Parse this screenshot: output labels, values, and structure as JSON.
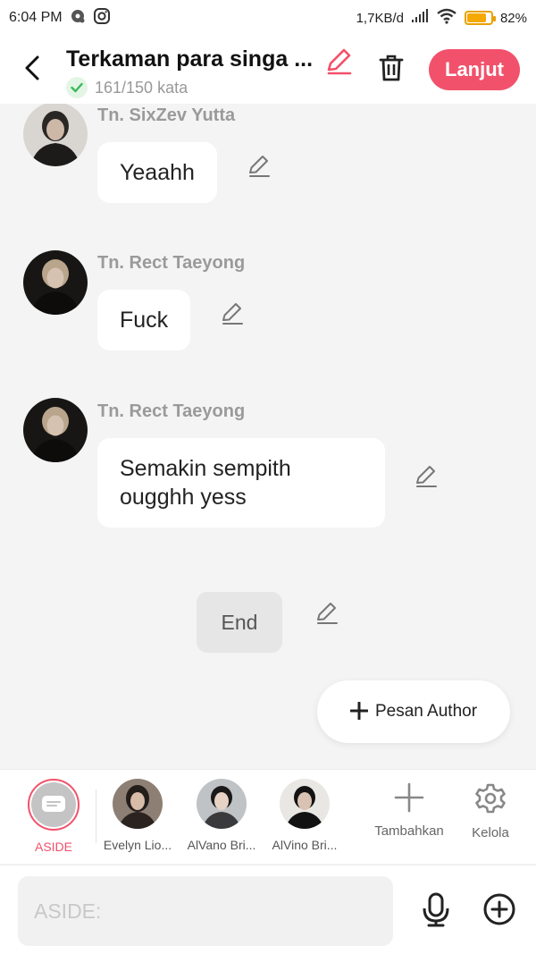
{
  "status_bar": {
    "time": "6:04 PM",
    "network_speed": "1,7KB/d",
    "battery_percent": "82%",
    "battery_level": 0.82
  },
  "header": {
    "title": "Terkaman para singa ...",
    "word_count": "161/150 kata",
    "next_label": "Lanjut",
    "accent_color": "#f2516b"
  },
  "messages": [
    {
      "sender": "Tn. SixZev Yutta",
      "text": "Yeaahh"
    },
    {
      "sender": "Tn. Rect Taeyong",
      "text": "Fuck"
    },
    {
      "sender": "Tn. Rect Taeyong",
      "text": "Semakin sempith\nougghh yess"
    }
  ],
  "end_label": "End",
  "author_button": {
    "label": "Pesan Author"
  },
  "characters": [
    {
      "name": "ASIDE",
      "selected": true
    },
    {
      "name": "Evelyn Lio..."
    },
    {
      "name": "AlVano Bri..."
    },
    {
      "name": "AlVino Bri..."
    }
  ],
  "tools": {
    "add_label": "Tambahkan",
    "manage_label": "Kelola"
  },
  "input": {
    "placeholder": "ASIDE:"
  }
}
